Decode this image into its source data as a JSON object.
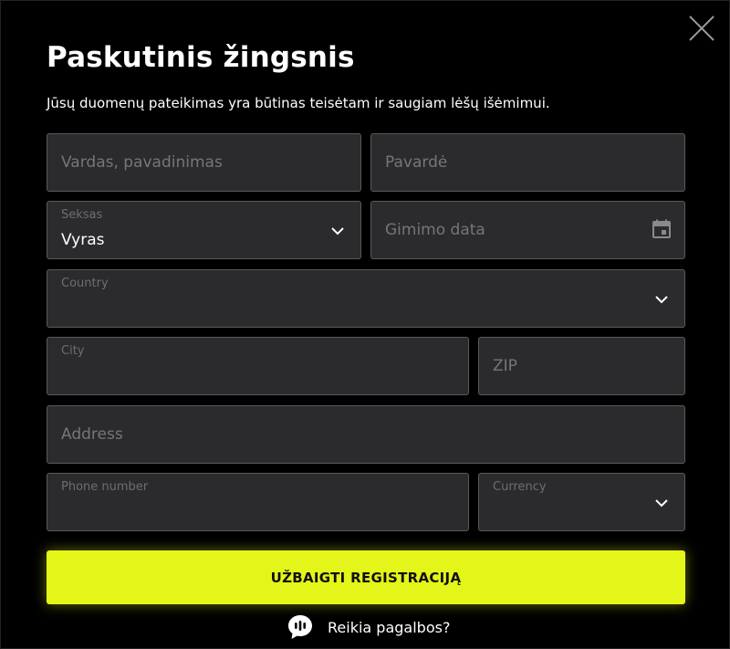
{
  "modal": {
    "title": "Paskutinis žingsnis",
    "subtitle": "Jūsų duomenų pateikimas yra būtinas teisėtam ir saugiam lėšų išėmimui."
  },
  "form": {
    "first_name": {
      "placeholder": "Vardas, pavadinimas"
    },
    "last_name": {
      "placeholder": "Pavardė"
    },
    "gender": {
      "label": "Seksas",
      "value": "Vyras"
    },
    "birth_date": {
      "placeholder": "Gimimo data"
    },
    "country": {
      "label": "Country",
      "value": ""
    },
    "city": {
      "label": "City",
      "value": ""
    },
    "zip": {
      "placeholder": "ZIP"
    },
    "address": {
      "placeholder": "Address"
    },
    "phone": {
      "label": "Phone number",
      "value": ""
    },
    "currency": {
      "label": "Currency",
      "value": ""
    }
  },
  "actions": {
    "submit_label": "UŽBAIGTI REGISTRACIJĄ",
    "help_label": "Reikia pagalbos?"
  },
  "icons": {
    "close": "close-icon",
    "calendar": "calendar-icon",
    "chevron": "chevron-down-icon",
    "support": "chat-bubble-icon"
  },
  "colors": {
    "background": "#000000",
    "field_bg": "#2b2b2d",
    "field_border": "#5a5a5c",
    "accent": "#e4f51a",
    "placeholder": "#76767a"
  }
}
